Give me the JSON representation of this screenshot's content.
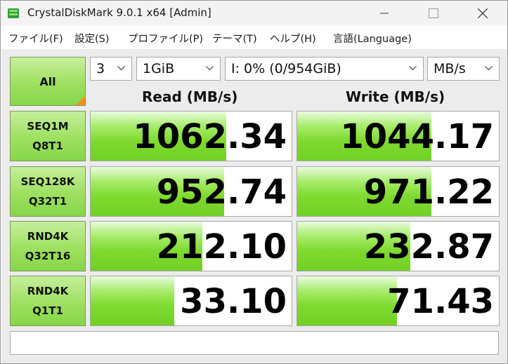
{
  "window": {
    "title": "CrystalDiskMark 9.0.1 x64 [Admin]"
  },
  "menu": {
    "items": [
      "ファイル(F)",
      "設定(S)",
      "プロファイル(P)",
      "テーマ(T)",
      "ヘルプ(H)",
      "言語(Language)"
    ]
  },
  "controls": {
    "all_label": "All",
    "count": "3",
    "size": "1GiB",
    "drive": "I: 0% (0/954GiB)",
    "unit": "MB/s"
  },
  "headers": {
    "read": "Read (MB/s)",
    "write": "Write (MB/s)"
  },
  "tests": [
    {
      "line1": "SEQ1M",
      "line2": "Q8T1",
      "read": "1062.34",
      "write": "1044.17",
      "read_fill": 0.675,
      "write_fill": 0.665
    },
    {
      "line1": "SEQ128K",
      "line2": "Q32T1",
      "read": "952.74",
      "write": "971.22",
      "read_fill": 0.665,
      "write_fill": 0.665
    },
    {
      "line1": "RND4K",
      "line2": "Q32T16",
      "read": "212.10",
      "write": "232.87",
      "read_fill": 0.555,
      "write_fill": 0.56
    },
    {
      "line1": "RND4K",
      "line2": "Q1T1",
      "read": "33.10",
      "write": "71.43",
      "read_fill": 0.415,
      "write_fill": 0.495
    }
  ],
  "comment": "",
  "colors": {
    "bar_green": "#7fda2e",
    "label_green": "#9ee060",
    "corner_orange": "#ff8c1a"
  }
}
